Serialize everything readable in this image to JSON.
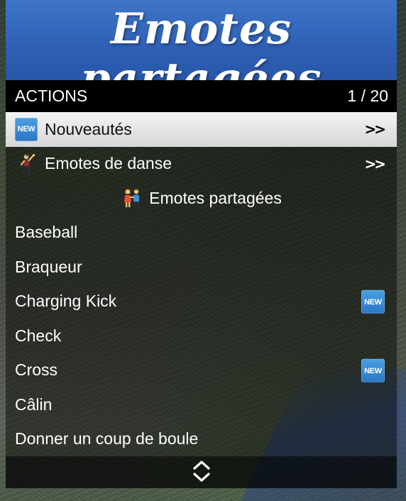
{
  "banner": {
    "title": "Emotes partagées"
  },
  "subheader": {
    "left": "ACTIONS",
    "right": "1 / 20"
  },
  "items": [
    {
      "label": "Nouveautés",
      "lead_icon": "new-badge",
      "badge_text": "NEW",
      "trailing": ">>",
      "selected": true
    },
    {
      "label": "Emotes de danse",
      "lead_icon": "dancer-icon",
      "trailing": ">>"
    },
    {
      "label": "Emotes partagées",
      "lead_icon": "couple-icon",
      "separator": true
    },
    {
      "label": "Baseball"
    },
    {
      "label": "Braqueur"
    },
    {
      "label": "Charging Kick",
      "badge_text": "NEW"
    },
    {
      "label": "Check"
    },
    {
      "label": "Cross",
      "badge_text": "NEW"
    },
    {
      "label": "Câlin"
    },
    {
      "label": "Donner un coup de boule"
    }
  ],
  "footer": {
    "icon": "up-down-chevron-icon"
  },
  "colors": {
    "banner_blue": "#2e5fb4",
    "selected_bg": "#e0e0e0",
    "new_badge_blue": "#2a76c4"
  }
}
